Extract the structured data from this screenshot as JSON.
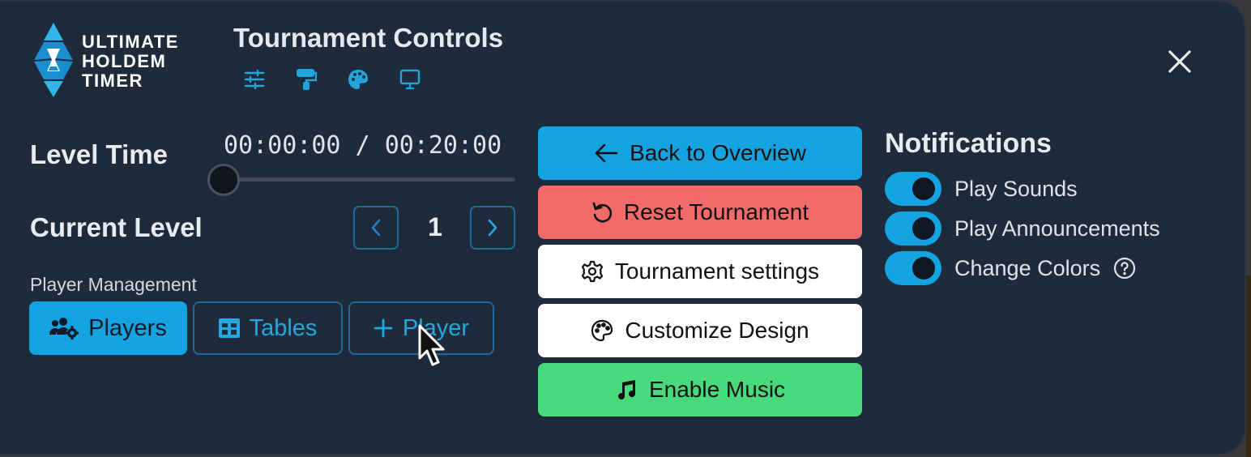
{
  "logo": {
    "line1": "ULTIMATE",
    "line2": "HOLDEM",
    "line3": "TIMER"
  },
  "header": {
    "title": "Tournament Controls",
    "tools": [
      "sliders-icon",
      "paint-roller-icon",
      "palette-icon",
      "monitor-icon"
    ]
  },
  "level_time": {
    "label": "Level Time",
    "elapsed": "00:00:00",
    "separator": "/",
    "total": "00:20:00",
    "progress": 0
  },
  "current_level": {
    "label": "Current Level",
    "value": "1"
  },
  "player_management": {
    "label": "Player Management",
    "players": "Players",
    "tables": "Tables",
    "add_player": "Player"
  },
  "actions": {
    "back": "Back to Overview",
    "reset": "Reset Tournament",
    "settings": "Tournament settings",
    "customize": "Customize Design",
    "music": "Enable Music"
  },
  "notifications": {
    "title": "Notifications",
    "items": [
      {
        "label": "Play Sounds",
        "on": true
      },
      {
        "label": "Play Announcements",
        "on": true
      },
      {
        "label": "Change Colors",
        "on": true
      }
    ]
  },
  "colors": {
    "panel_bg": "#1f2a3b",
    "accent_blue": "#12a3e0",
    "reset_red": "#f26b6b",
    "music_green": "#47d97b",
    "white": "#ffffff"
  }
}
